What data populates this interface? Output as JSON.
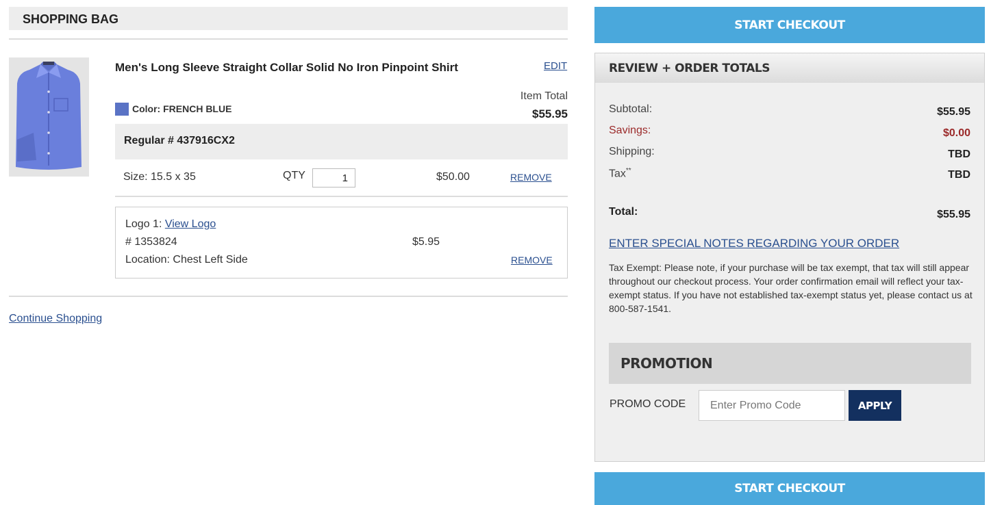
{
  "bag": {
    "title": "SHOPPING BAG",
    "continue_label": "Continue Shopping"
  },
  "item": {
    "name": "Men's Long Sleeve Straight Collar Solid No Iron Pinpoint Shirt",
    "edit_label": "EDIT",
    "item_total_label": "Item Total",
    "item_total": "$55.95",
    "color_label": "Color: FRENCH BLUE",
    "color_hex": "#5a73c5",
    "regular_label": "Regular # 437916CX2",
    "size": "Size: 15.5 x 35",
    "qty_label": "QTY",
    "qty": "1",
    "price": "$50.00",
    "remove_label": "REMOVE"
  },
  "logo": {
    "label": "Logo 1:",
    "view_label": "View Logo",
    "number": "# 1353824",
    "location": "Location: Chest Left Side",
    "price": "$5.95",
    "remove_label": "REMOVE"
  },
  "checkout": {
    "label": "START CHECKOUT",
    "color": "#4aa8dc"
  },
  "totals": {
    "title": "REVIEW + ORDER TOTALS",
    "subtotal_label": "Subtotal:",
    "subtotal": "$55.95",
    "savings_label": "Savings:",
    "savings": "$0.00",
    "shipping_label": "Shipping:",
    "shipping": "TBD",
    "tax_label": "Tax",
    "tax_mark": "**",
    "tax": "TBD",
    "total_label": "Total:",
    "total": "$55.95",
    "notes_link": "ENTER SPECIAL NOTES REGARDING YOUR ORDER",
    "tax_note": "Tax Exempt: Please note, if your purchase will be tax exempt, that tax will still appear throughout our checkout process. Your order confirmation email will reflect your tax-exempt status. If you have not established tax-exempt status yet, please contact us at 800-587-1541."
  },
  "promotion": {
    "title": "PROMOTION",
    "code_label": "PROMO CODE",
    "placeholder": "Enter Promo Code",
    "apply_label": "APPLY",
    "apply_color": "#13305f"
  }
}
